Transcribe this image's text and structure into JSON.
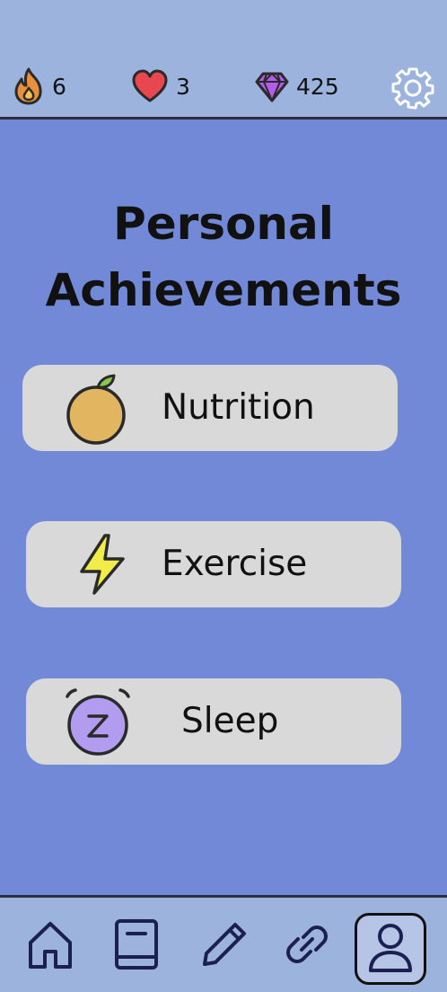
{
  "stats": {
    "streak": {
      "value": "6",
      "icon": "flame-icon",
      "color": "#e8903c"
    },
    "lives": {
      "value": "3",
      "icon": "heart-icon",
      "color": "#e8474f"
    },
    "gems": {
      "value": "425",
      "icon": "gem-icon",
      "color": "#b25de6"
    }
  },
  "settings": {
    "icon": "gear-icon"
  },
  "title": {
    "line1": "Personal",
    "line2": "Achievements"
  },
  "categories": [
    {
      "label": "Nutrition",
      "icon": "orange-icon",
      "color": "#e2b660"
    },
    {
      "label": "Exercise",
      "icon": "lightning-icon",
      "color": "#f2ec4a"
    },
    {
      "label": "Sleep",
      "icon": "alarm-clock-icon",
      "color": "#b29cf0"
    }
  ],
  "nav": [
    {
      "name": "home",
      "icon": "home-icon"
    },
    {
      "name": "book",
      "icon": "book-icon"
    },
    {
      "name": "pencil",
      "icon": "pencil-icon"
    },
    {
      "name": "link",
      "icon": "link-icon"
    },
    {
      "name": "profile",
      "icon": "user-icon",
      "active": true
    }
  ],
  "colors": {
    "background": "#7289d7",
    "bars": "#9bb3dd",
    "card": "#d9d9d9"
  }
}
